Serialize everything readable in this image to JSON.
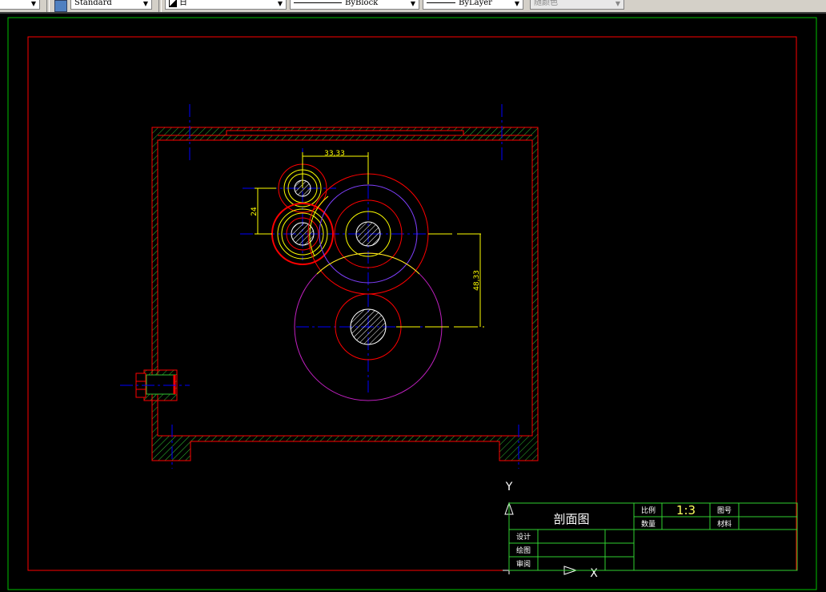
{
  "toolbar": {
    "text_style": "Standard",
    "layer": "日",
    "linetype": "ByBlock",
    "lineweight": "ByLayer",
    "color": "随颜色"
  },
  "drawing": {
    "dim_horizontal": "33,33",
    "dim_vertical_small": "24",
    "dim_vertical_large": "48,33",
    "ucs_x": "X",
    "ucs_y": "Y"
  },
  "title_block": {
    "title": "剖面图",
    "scale_label": "比例",
    "scale_value": "1:3",
    "drawing_no_label": "图号",
    "quantity_label": "数量",
    "material_label": "材料",
    "design_label": "设计",
    "drafting_label": "绘图",
    "review_label": "审阅"
  },
  "colors": {
    "background": "#000000",
    "border_green": "#00c000",
    "outline_red": "#ff0000",
    "center_blue": "#0000ff",
    "dimension_yellow": "#ffff00"
  }
}
